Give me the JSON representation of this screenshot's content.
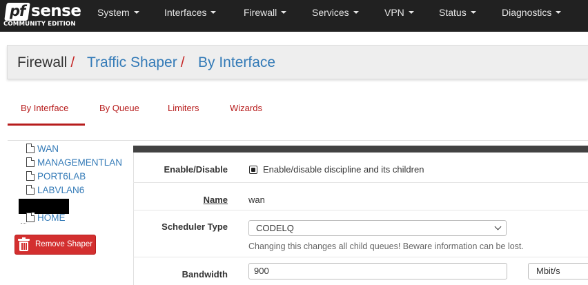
{
  "brand": {
    "name_pf": "pf",
    "name_sense": "sense",
    "edition": "COMMUNITY EDITION"
  },
  "nav": {
    "items": [
      {
        "label": "System"
      },
      {
        "label": "Interfaces"
      },
      {
        "label": "Firewall"
      },
      {
        "label": "Services"
      },
      {
        "label": "VPN"
      },
      {
        "label": "Status"
      },
      {
        "label": "Diagnostics"
      }
    ]
  },
  "breadcrumb": {
    "first": "Firewall",
    "second": "Traffic Shaper",
    "third": "By Interface",
    "separator": "/"
  },
  "tabs": [
    {
      "label": "By Interface",
      "active": true
    },
    {
      "label": "By Queue",
      "active": false
    },
    {
      "label": "Limiters",
      "active": false
    },
    {
      "label": "Wizards",
      "active": false
    }
  ],
  "tree": {
    "items": [
      "WAN",
      "MANAGEMENTLAN",
      "PORT6LAB",
      "LABVLAN6",
      "HOME"
    ]
  },
  "remove_button": {
    "label": "Remove Shaper"
  },
  "form": {
    "enable_label": "Enable/Disable",
    "enable_checkbox_text": "Enable/disable discipline and its children",
    "enable_checked": true,
    "name_label": "Name",
    "name_value": "wan",
    "scheduler_label": "Scheduler Type",
    "scheduler_value": "CODELQ",
    "scheduler_help": "Changing this changes all child queues! Beware information can be lost.",
    "bandwidth_label": "Bandwidth",
    "bandwidth_value": "900",
    "bandwidth_unit": "Mbit/s"
  },
  "colors": {
    "navbar": "#212121",
    "accent_red": "#b71c1c",
    "link_blue": "#337ab7",
    "button_red": "#d32f2f",
    "panel_header": "#424242"
  }
}
